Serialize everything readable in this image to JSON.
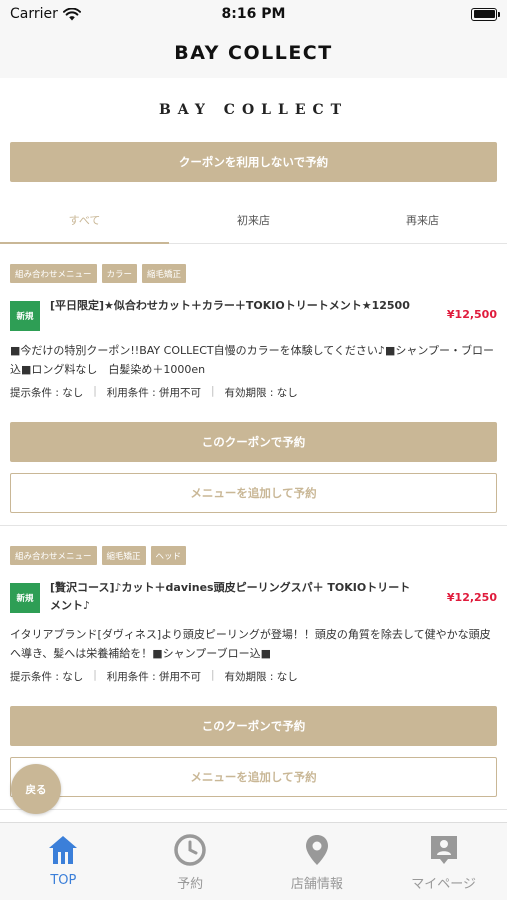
{
  "status_bar": {
    "carrier": "Carrier",
    "time": "8:16 PM"
  },
  "header": {
    "title": "BAY COLLECT"
  },
  "logo": {
    "text": "BAY COLLECT"
  },
  "reserve_no_coupon_label": "クーポンを利用しないで予約",
  "tabs": [
    {
      "label": "すべて",
      "active": true
    },
    {
      "label": "初来店",
      "active": false
    },
    {
      "label": "再来店",
      "active": false
    }
  ],
  "coupons": [
    {
      "tags": [
        "組み合わせメニュー",
        "カラー",
        "縮毛矯正"
      ],
      "badge": "新規",
      "title": "[平日限定]★似合わせカット＋カラー＋TOKIOトリートメント★12500",
      "price": "¥12,500",
      "description": "■今だけの特別クーポン!!BAY COLLECT自慢のカラーを体験してください♪■シャンプー・ブロー込■ロング料なし　白髪染め＋1000en",
      "conditions": [
        "提示条件 : なし",
        "利用条件 : 併用不可",
        "有効期限 : なし"
      ],
      "reserve_label": "このクーポンで予約",
      "add_menu_label": "メニューを追加して予約"
    },
    {
      "tags": [
        "組み合わせメニュー",
        "縮毛矯正",
        "ヘッド"
      ],
      "badge": "新規",
      "title": "[贅沢コース]♪カット＋davines頭皮ピーリングスパ＋ TOKIOトリートメント♪",
      "price": "¥12,250",
      "description": "イタリアブランド[ダヴィネス]より頭皮ピーリングが登場！！頭皮の角質を除去して健やかな頭皮へ導き、髪へは栄養補給を！■シャンプーブロー込■",
      "conditions": [
        "提示条件 : なし",
        "利用条件 : 併用不可",
        "有効期限 : なし"
      ],
      "reserve_label": "このクーポンで予約",
      "add_menu_label": "メニューを追加して予約"
    }
  ],
  "back_button_label": "戻る",
  "tabbar": [
    {
      "label": "TOP",
      "icon": "home-icon",
      "active": true
    },
    {
      "label": "予約",
      "icon": "clock-icon",
      "active": false
    },
    {
      "label": "店舗情報",
      "icon": "location-pin-icon",
      "active": false
    },
    {
      "label": "マイページ",
      "icon": "user-card-icon",
      "active": false
    }
  ],
  "colors": {
    "accent": "#c9b796",
    "price": "#e01b3c",
    "new_badge": "#2e9e55",
    "tab_active": "#3b7fd9"
  }
}
